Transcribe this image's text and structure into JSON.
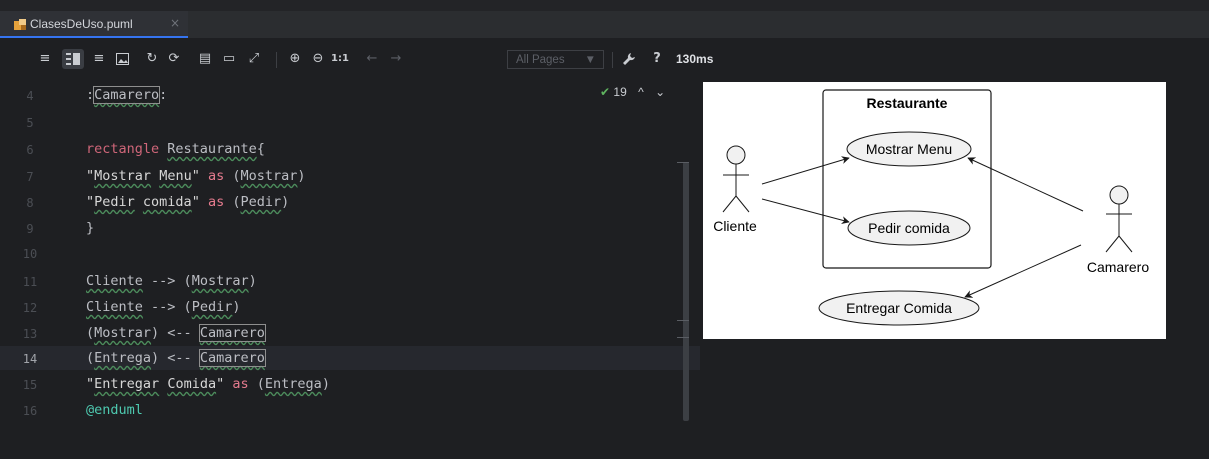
{
  "tab": {
    "filename": "ClasesDeUso.puml",
    "close": "×"
  },
  "toolbar": {
    "zoom_actual": "1:1",
    "pages_dropdown": "All Pages",
    "help": "?",
    "render_time": "130ms"
  },
  "editor": {
    "line_numbers": [
      "4",
      "5",
      "6",
      "7",
      "8",
      "9",
      "10",
      "11",
      "12",
      "13",
      "14",
      "15",
      "16"
    ],
    "active_line": "14",
    "inspection_count": "19"
  },
  "diagram": {
    "rectangle_title": "Restaurante",
    "actors": [
      "Cliente",
      "Camarero"
    ],
    "usecases": [
      "Mostrar Menu",
      "Pedir comida",
      "Entregar Comida"
    ]
  }
}
